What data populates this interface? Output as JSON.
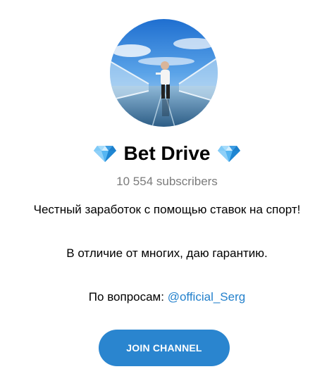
{
  "channel": {
    "title": "Bet Drive",
    "subscribers": "10 554 subscribers",
    "title_icon": "diamond-icon",
    "avatar_icon": "avatar-photo"
  },
  "description": {
    "line1": "Честный заработок с помощью ставок на спорт!",
    "line2": "В отличие от многих, даю гарантию.",
    "line3_prefix": "По вопросам: ",
    "line3_mention": "@official_Serg"
  },
  "actions": {
    "join_label": "JOIN CHANNEL"
  },
  "colors": {
    "accent": "#2a85cf",
    "link": "#2481cc",
    "muted_text": "#7b7b7b",
    "diamond": "#3ba7ee"
  }
}
